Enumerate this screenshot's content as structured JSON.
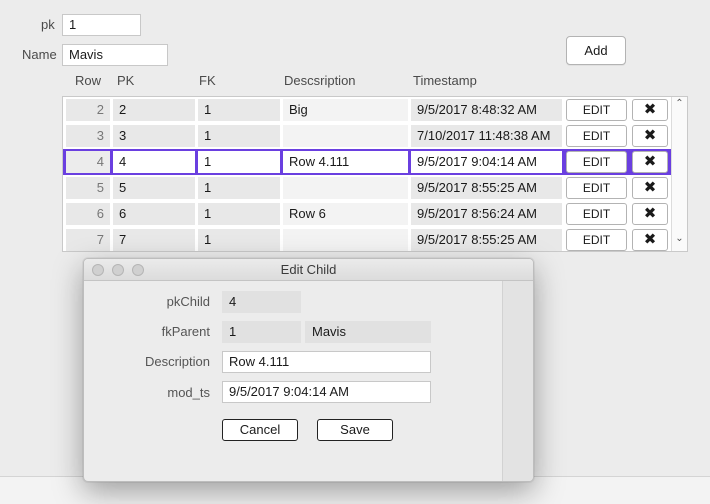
{
  "form": {
    "pk_label": "pk",
    "pk_value": "1",
    "name_label": "Name",
    "name_value": "Mavis",
    "add_label": "Add"
  },
  "grid": {
    "columns": [
      "Row",
      "PK",
      "FK",
      "Descsription",
      "Timestamp"
    ],
    "edit_label": "EDIT",
    "delete_glyph": "✖",
    "rows": [
      {
        "row": "2",
        "pk": "2",
        "fk": "1",
        "desc": "Big",
        "ts": "9/5/2017 8:48:32 AM"
      },
      {
        "row": "3",
        "pk": "3",
        "fk": "1",
        "desc": "",
        "ts": "7/10/2017 11:48:38 AM"
      },
      {
        "row": "4",
        "pk": "4",
        "fk": "1",
        "desc": "Row 4.111",
        "ts": "9/5/2017 9:04:14 AM"
      },
      {
        "row": "5",
        "pk": "5",
        "fk": "1",
        "desc": "",
        "ts": "9/5/2017 8:55:25 AM"
      },
      {
        "row": "6",
        "pk": "6",
        "fk": "1",
        "desc": "Row 6",
        "ts": "9/5/2017 8:56:24 AM"
      },
      {
        "row": "7",
        "pk": "7",
        "fk": "1",
        "desc": "",
        "ts": "9/5/2017 8:55:25 AM"
      }
    ],
    "scroll_up": "⌃",
    "scroll_down": "⌄"
  },
  "dialog": {
    "title": "Edit Child",
    "pkchild_label": "pkChild",
    "pkchild_value": "4",
    "fkparent_label": "fkParent",
    "fkparent_value": "1",
    "fkparent_name": "Mavis",
    "description_label": "Description",
    "description_value": "Row 4.111",
    "modts_label": "mod_ts",
    "modts_value": "9/5/2017 9:04:14 AM",
    "cancel_label": "Cancel",
    "save_label": "Save"
  },
  "colors": {
    "selection": "#6a3fe0",
    "window_bg": "#ececec"
  }
}
